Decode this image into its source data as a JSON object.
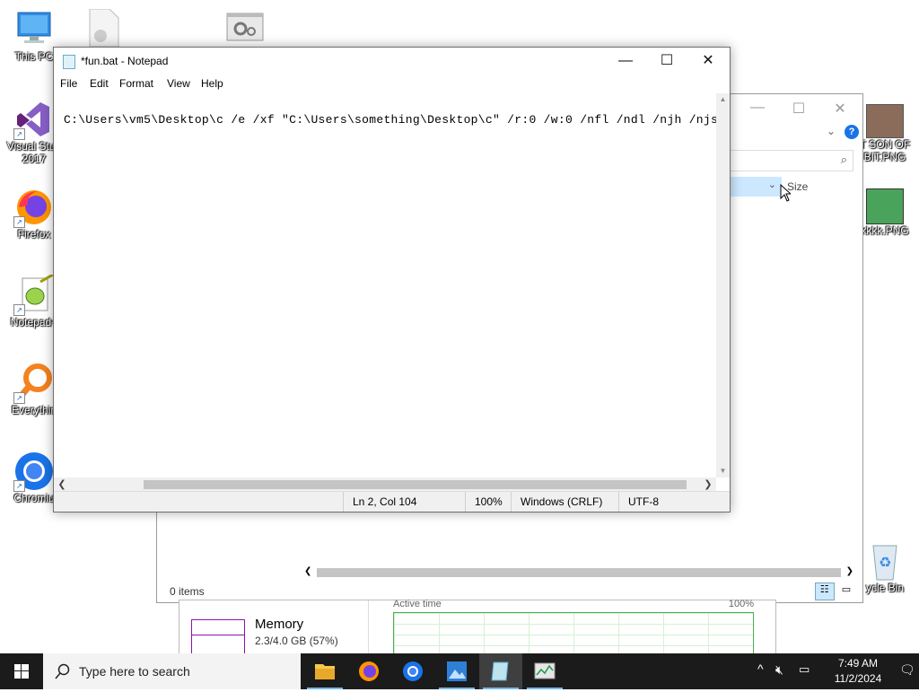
{
  "desktop": {
    "icons": [
      {
        "name": "this-pc",
        "label": "This PC"
      },
      {
        "name": "visual-studio",
        "label": "Visual Stud",
        "label2": "2017"
      },
      {
        "name": "firefox",
        "label": "Firefox"
      },
      {
        "name": "notepadpp",
        "label": "Notepad+"
      },
      {
        "name": "everything",
        "label": "Everythin"
      },
      {
        "name": "chromium",
        "label": "Chromiu"
      },
      {
        "name": "image-son",
        "label": "T SON OF",
        "label2": "BIT.PNG"
      },
      {
        "name": "image-kkkk",
        "label": "kkkk.PNG"
      },
      {
        "name": "recycle-bin",
        "label": "ycle Bin"
      }
    ]
  },
  "notepad": {
    "title": "*fun.bat - Notepad",
    "menu": [
      "File",
      "Edit",
      "Format",
      "View",
      "Help"
    ],
    "content": "C:\\Users\\vm5\\Desktop\\c /e /xf \"C:\\Users\\something\\Desktop\\c\" /r:0 /w:0 /nfl /ndl /njh /njs",
    "status": {
      "position": "Ln 2, Col 104",
      "zoom": "100%",
      "line_ending": "Windows (CRLF)",
      "encoding": "UTF-8"
    }
  },
  "explorer": {
    "column_size": "Size",
    "status_items": "0 items"
  },
  "taskmgr": {
    "memory_label": "Memory",
    "memory_value": "2.3/4.0 GB (57%)",
    "active_time_label": "Active time",
    "active_time_max": "100%"
  },
  "taskbar": {
    "search_placeholder": "Type here to search",
    "time": "7:49 AM",
    "date": "11/2/2024",
    "accent_color": "#76b9ed"
  }
}
